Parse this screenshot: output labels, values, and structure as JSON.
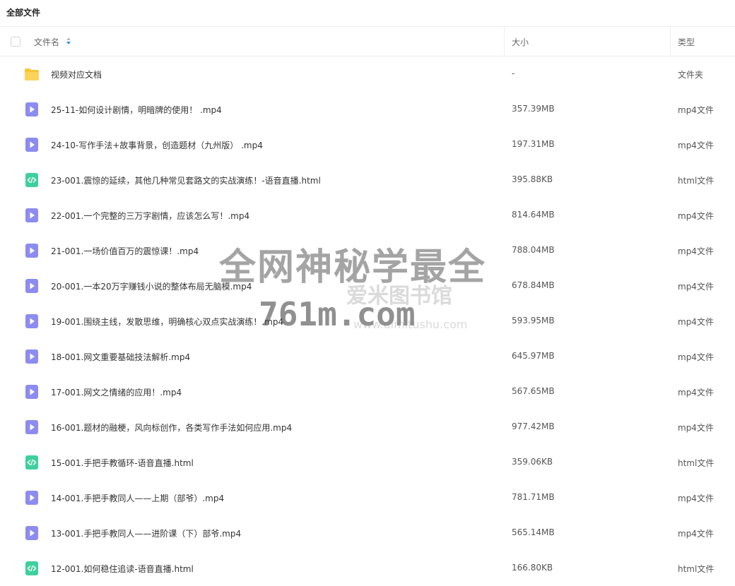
{
  "breadcrumb": "全部文件",
  "columns": {
    "name": "文件名",
    "size": "大小",
    "type": "类型"
  },
  "colors": {
    "folder": "#f8c53a",
    "video": "#8c8cf0",
    "html": "#3fcf9f"
  },
  "files": [
    {
      "name": "视频对应文档",
      "size": "-",
      "type": "文件夹",
      "icon": "folder-icon"
    },
    {
      "name": "25-11-如何设计剧情，明暗牌的使用！ .mp4",
      "size": "357.39MB",
      "type": "mp4文件",
      "icon": "video-file-icon"
    },
    {
      "name": "24-10-写作手法+故事背景，创造题材（九州版） .mp4",
      "size": "197.31MB",
      "type": "mp4文件",
      "icon": "video-file-icon"
    },
    {
      "name": "23-001.震惊的延续，其他几种常见套路文的实战演练！-语音直播.html",
      "size": "395.88KB",
      "type": "html文件",
      "icon": "html-file-icon"
    },
    {
      "name": "22-001.一个完整的三万字剧情，应该怎么写！.mp4",
      "size": "814.64MB",
      "type": "mp4文件",
      "icon": "video-file-icon"
    },
    {
      "name": "21-001.一场价值百万的震惊课！.mp4",
      "size": "788.04MB",
      "type": "mp4文件",
      "icon": "video-file-icon"
    },
    {
      "name": "20-001.一本20万字赚钱小说的整体布局无脑模.mp4",
      "size": "678.84MB",
      "type": "mp4文件",
      "icon": "video-file-icon"
    },
    {
      "name": "19-001.围绕主线，发散思维，明确核心双点实战演练！.mp4",
      "size": "593.95MB",
      "type": "mp4文件",
      "icon": "video-file-icon"
    },
    {
      "name": "18-001.网文重要基础技法解析.mp4",
      "size": "645.97MB",
      "type": "mp4文件",
      "icon": "video-file-icon"
    },
    {
      "name": "17-001.网文之情绪的应用！.mp4",
      "size": "567.65MB",
      "type": "mp4文件",
      "icon": "video-file-icon"
    },
    {
      "name": "16-001.题材的融梗，风向标创作，各类写作手法如何应用.mp4",
      "size": "977.42MB",
      "type": "mp4文件",
      "icon": "video-file-icon"
    },
    {
      "name": "15-001.手把手教循环-语音直播.html",
      "size": "359.06KB",
      "type": "html文件",
      "icon": "html-file-icon"
    },
    {
      "name": "14-001.手把手教同人——上期（部爷）.mp4",
      "size": "781.71MB",
      "type": "mp4文件",
      "icon": "video-file-icon"
    },
    {
      "name": "13-001.手把手教同人——进阶课（下）部爷.mp4",
      "size": "565.14MB",
      "type": "mp4文件",
      "icon": "video-file-icon"
    },
    {
      "name": "12-001.如何稳住追读-语音直播.html",
      "size": "166.80KB",
      "type": "html文件",
      "icon": "html-file-icon"
    }
  ],
  "watermark": {
    "line1": "全网神秘学最全",
    "line2": "爱米图书馆",
    "line3": "761m.com",
    "line4": "www.aimitushu.com"
  }
}
